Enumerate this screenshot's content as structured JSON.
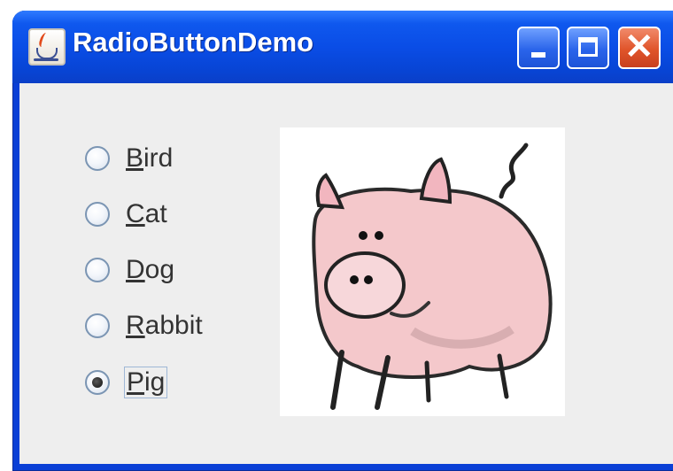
{
  "window": {
    "title": "RadioButtonDemo",
    "controls": {
      "minimize": "minimize",
      "maximize": "maximize",
      "close": "close"
    }
  },
  "radios": [
    {
      "mnemonic": "B",
      "rest": "ird",
      "checked": false
    },
    {
      "mnemonic": "C",
      "rest": "at",
      "checked": false
    },
    {
      "mnemonic": "D",
      "rest": "og",
      "checked": false
    },
    {
      "mnemonic": "R",
      "rest": "abbit",
      "checked": false
    },
    {
      "mnemonic": "P",
      "rest": "ig",
      "checked": true
    }
  ],
  "image": {
    "subject": "pig"
  },
  "icons": {
    "app": "java-coffee-cup-icon",
    "minimize": "minimize-icon",
    "maximize": "maximize-icon",
    "close": "close-icon"
  },
  "colors": {
    "titlebar": "#0a4de6",
    "panel": "#eeeeee",
    "close": "#e0542a"
  }
}
